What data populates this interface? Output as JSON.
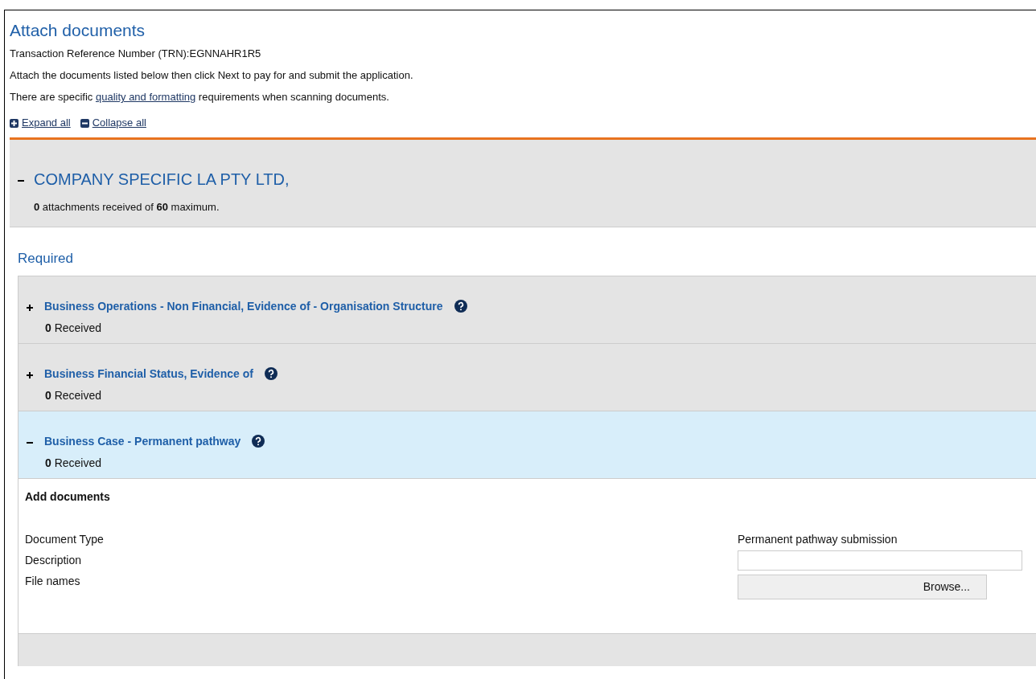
{
  "page": {
    "title": "Attach documents",
    "trn": "Transaction Reference Number (TRN):EGNNAHR1R5",
    "instruction": "Attach the documents listed below then click Next to pay for and submit the application.",
    "note_before": "There are specific ",
    "note_link": "quality and formatting",
    "note_after": " requirements when scanning documents."
  },
  "toolbar": [
    {
      "label": "Expand all",
      "kind": "expand"
    },
    {
      "label": "Collapse all",
      "kind": "collapse"
    }
  ],
  "applicant": {
    "name": "COMPANY SPECIFIC LA PTY LTD,",
    "expanded": true,
    "summary": "**0** attachments received of **60** maximum."
  },
  "section_title": "Required",
  "documents": [
    {
      "title": "Business Operations - Non Financial, Evidence of - Organisation Structure",
      "received": "**0** Received",
      "expanded": false
    },
    {
      "title": "Business Financial Status, Evidence of",
      "received": "**0** Received",
      "expanded": false
    },
    {
      "title": "Business Case - Permanent pathway",
      "received": "**0** Received",
      "expanded": true
    }
  ],
  "add_form": {
    "heading": "Add documents",
    "fields": [
      {
        "label": "Document Type",
        "kind": "value",
        "value": "Permanent pathway submission"
      },
      {
        "label": "Description",
        "kind": "input"
      },
      {
        "label": "File names",
        "kind": "file",
        "button": "Browse..."
      }
    ]
  }
}
